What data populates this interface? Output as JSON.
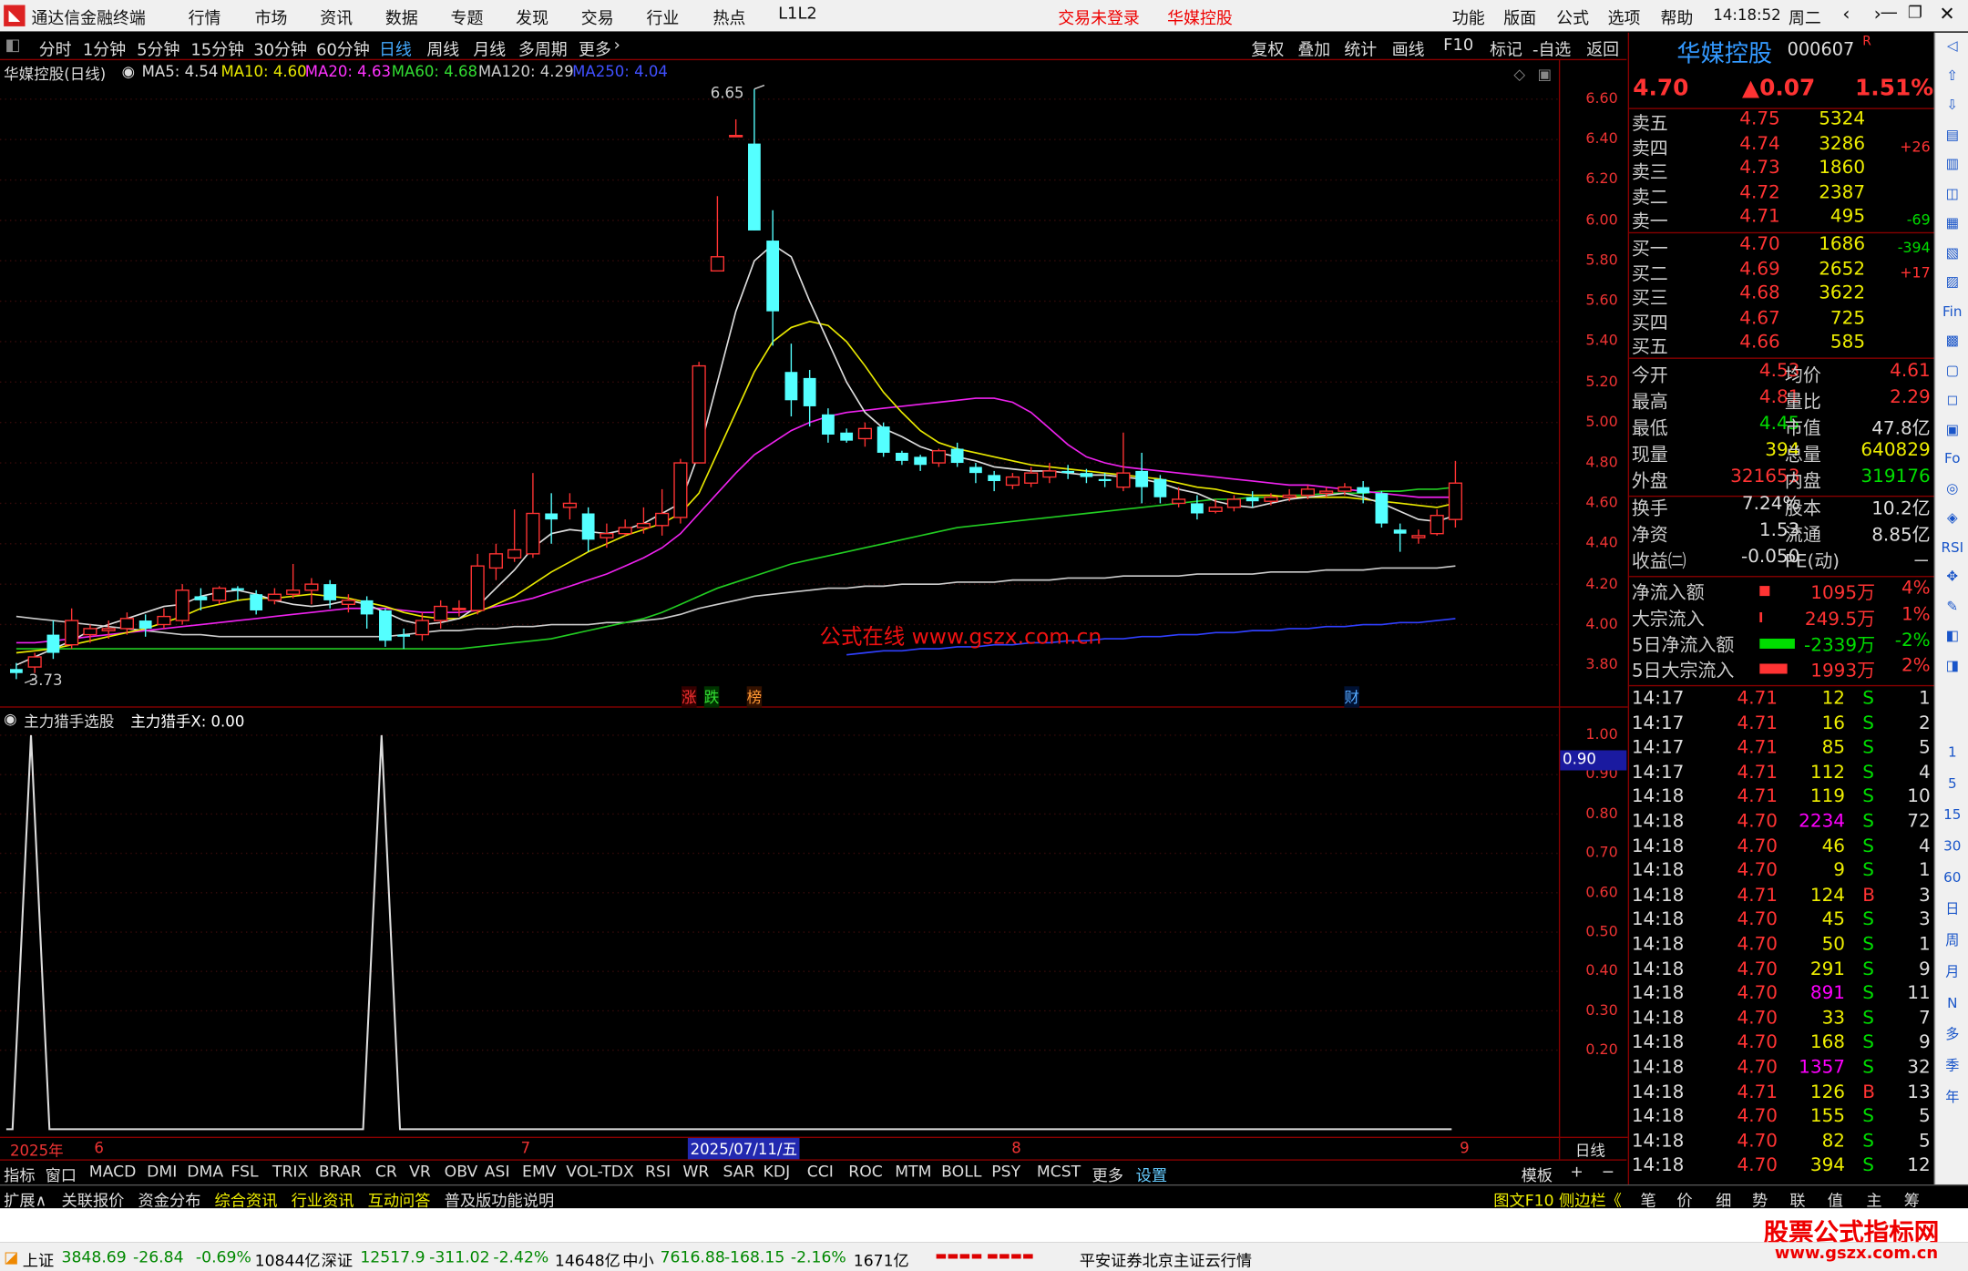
{
  "titlebar": {
    "app_name": "通达信金融终端",
    "menus": [
      "行情",
      "市场",
      "资讯",
      "数据",
      "专题",
      "发现",
      "交易",
      "行业",
      "热点",
      "L1L2"
    ],
    "trade_status": "交易未登录",
    "stock_name": "华媒控股",
    "right_menus": [
      "功能",
      "版面",
      "公式",
      "选项",
      "帮助"
    ],
    "time": "14:18:52",
    "weekday": "周二"
  },
  "periods": [
    "分时",
    "1分钟",
    "5分钟",
    "15分钟",
    "30分钟",
    "60分钟",
    "日线",
    "周线",
    "月线",
    "多周期",
    "更多"
  ],
  "active_period": "日线",
  "tools": [
    "复权",
    "叠加",
    "统计",
    "画线",
    "F10",
    "标记",
    "-自选",
    "返回"
  ],
  "main": {
    "title": "华媒控股(日线)",
    "ma": [
      {
        "label": "MA5: 4.54",
        "color": "#dddddd"
      },
      {
        "label": "MA10: 4.60",
        "color": "#e8e800"
      },
      {
        "label": "MA20: 4.63",
        "color": "#ff33ff"
      },
      {
        "label": "MA60: 4.68",
        "color": "#33dd33"
      },
      {
        "label": "MA120: 4.29",
        "color": "#cccccc"
      },
      {
        "label": "MA250: 4.04",
        "color": "#4050ff"
      }
    ],
    "high_label": "6.65",
    "low_label": "3.73",
    "watermark": "公式在线  www.gszx.com.cn",
    "markers": [
      "涨",
      "跌",
      "榜",
      "财"
    ]
  },
  "yaxis": [
    "6.60",
    "6.40",
    "6.20",
    "6.00",
    "5.80",
    "5.60",
    "5.40",
    "5.20",
    "5.00",
    "4.80",
    "4.60",
    "4.40",
    "4.20",
    "4.00",
    "3.80"
  ],
  "sub": {
    "title": "主力猎手选股",
    "value_label": "主力猎手X: 0.00",
    "yaxis": [
      "1.00",
      "0.90",
      "0.80",
      "0.70",
      "0.60",
      "0.50",
      "0.40",
      "0.30",
      "0.20"
    ],
    "marker": "0.90"
  },
  "xaxis": {
    "year": "2025年",
    "months": [
      "6",
      "7",
      "8",
      "9"
    ],
    "cursor_date": "2025/07/11/五",
    "period_label": "日线"
  },
  "chart_data": {
    "type": "candlestick",
    "ylim": [
      3.7,
      6.7
    ],
    "candles": [
      [
        3.78,
        3.76,
        3.81,
        3.73
      ],
      [
        3.79,
        3.84,
        3.86,
        3.76
      ],
      [
        3.95,
        3.86,
        4.02,
        3.83
      ],
      [
        3.9,
        4.02,
        4.08,
        3.88
      ],
      [
        3.95,
        3.98,
        4.0,
        3.91
      ],
      [
        3.97,
        3.98,
        4.02,
        3.93
      ],
      [
        3.98,
        4.03,
        4.06,
        3.95
      ],
      [
        4.02,
        3.98,
        4.05,
        3.94
      ],
      [
        4.0,
        4.04,
        4.08,
        3.98
      ],
      [
        4.02,
        4.17,
        4.2,
        4.0
      ],
      [
        4.14,
        4.12,
        4.18,
        4.07
      ],
      [
        4.12,
        4.18,
        4.19,
        4.1
      ],
      [
        4.18,
        4.17,
        4.19,
        4.12
      ],
      [
        4.15,
        4.07,
        4.17,
        4.05
      ],
      [
        4.12,
        4.15,
        4.18,
        4.1
      ],
      [
        4.15,
        4.17,
        4.3,
        4.13
      ],
      [
        4.17,
        4.2,
        4.23,
        4.1
      ],
      [
        4.2,
        4.12,
        4.22,
        4.08
      ],
      [
        4.1,
        4.12,
        4.15,
        4.06
      ],
      [
        4.12,
        4.05,
        4.14,
        3.98
      ],
      [
        4.07,
        3.92,
        4.08,
        3.89
      ],
      [
        3.95,
        3.94,
        3.98,
        3.88
      ],
      [
        3.95,
        4.02,
        4.06,
        3.92
      ],
      [
        4.02,
        4.09,
        4.12,
        3.98
      ],
      [
        4.08,
        4.08,
        4.12,
        4.04
      ],
      [
        4.07,
        4.29,
        4.35,
        4.05
      ],
      [
        4.28,
        4.35,
        4.4,
        4.22
      ],
      [
        4.33,
        4.37,
        4.57,
        4.31
      ],
      [
        4.35,
        4.55,
        4.75,
        4.33
      ],
      [
        4.55,
        4.52,
        4.65,
        4.4
      ],
      [
        4.58,
        4.6,
        4.65,
        4.52
      ],
      [
        4.55,
        4.42,
        4.58,
        4.36
      ],
      [
        4.43,
        4.45,
        4.5,
        4.38
      ],
      [
        4.45,
        4.48,
        4.52,
        4.44
      ],
      [
        4.48,
        4.5,
        4.58,
        4.45
      ],
      [
        4.49,
        4.55,
        4.67,
        4.44
      ],
      [
        4.53,
        4.8,
        4.82,
        4.5
      ],
      [
        4.8,
        5.28,
        5.3,
        5.0
      ],
      [
        5.75,
        5.82,
        6.12,
        5.75
      ],
      [
        6.42,
        6.42,
        6.5,
        6.42
      ],
      [
        6.38,
        5.95,
        6.65,
        5.95
      ],
      [
        5.9,
        5.55,
        6.05,
        5.38
      ],
      [
        5.25,
        5.11,
        5.39,
        5.03
      ],
      [
        5.22,
        5.08,
        5.26,
        4.98
      ],
      [
        5.04,
        4.94,
        5.07,
        4.9
      ],
      [
        4.95,
        4.91,
        4.97,
        4.9
      ],
      [
        4.92,
        4.97,
        5.0,
        4.88
      ],
      [
        4.98,
        4.85,
        5.0,
        4.83
      ],
      [
        4.85,
        4.81,
        4.86,
        4.79
      ],
      [
        4.83,
        4.79,
        4.84,
        4.76
      ],
      [
        4.8,
        4.86,
        4.87,
        4.78
      ],
      [
        4.87,
        4.8,
        4.9,
        4.78
      ],
      [
        4.78,
        4.75,
        4.8,
        4.7
      ],
      [
        4.74,
        4.71,
        4.76,
        4.66
      ],
      [
        4.69,
        4.73,
        4.75,
        4.67
      ],
      [
        4.7,
        4.75,
        4.78,
        4.68
      ],
      [
        4.73,
        4.76,
        4.8,
        4.7
      ],
      [
        4.76,
        4.75,
        4.79,
        4.72
      ],
      [
        4.75,
        4.73,
        4.77,
        4.7
      ],
      [
        4.72,
        4.71,
        4.75,
        4.68
      ],
      [
        4.68,
        4.75,
        4.95,
        4.66
      ],
      [
        4.76,
        4.68,
        4.85,
        4.6
      ],
      [
        4.72,
        4.63,
        4.74,
        4.6
      ],
      [
        4.6,
        4.62,
        4.68,
        4.58
      ],
      [
        4.6,
        4.55,
        4.64,
        4.52
      ],
      [
        4.56,
        4.58,
        4.62,
        4.55
      ],
      [
        4.58,
        4.62,
        4.64,
        4.56
      ],
      [
        4.63,
        4.61,
        4.66,
        4.58
      ],
      [
        4.61,
        4.63,
        4.65,
        4.59
      ],
      [
        4.63,
        4.64,
        4.67,
        4.61
      ],
      [
        4.64,
        4.67,
        4.69,
        4.62
      ],
      [
        4.65,
        4.66,
        4.68,
        4.63
      ],
      [
        4.66,
        4.68,
        4.7,
        4.64
      ],
      [
        4.68,
        4.65,
        4.71,
        4.6
      ],
      [
        4.65,
        4.5,
        4.66,
        4.48
      ],
      [
        4.47,
        4.45,
        4.5,
        4.36
      ],
      [
        4.43,
        4.44,
        4.47,
        4.4
      ],
      [
        4.45,
        4.54,
        4.57,
        4.44
      ],
      [
        4.52,
        4.7,
        4.81,
        4.48
      ]
    ]
  },
  "ma_lines": {
    "ma5": [
      3.8,
      3.84,
      3.88,
      3.92,
      3.97,
      4.0,
      4.03,
      4.06,
      4.09,
      4.1,
      4.14,
      4.16,
      4.17,
      4.15,
      4.12,
      4.1,
      4.09,
      4.1,
      4.12,
      4.1,
      4.06,
      4.02,
      4.0,
      4.01,
      4.03,
      4.09,
      4.18,
      4.27,
      4.38,
      4.45,
      4.47,
      4.46,
      4.45,
      4.47,
      4.5,
      4.55,
      4.6,
      4.85,
      5.2,
      5.55,
      5.8,
      5.88,
      5.82,
      5.6,
      5.4,
      5.2,
      5.05,
      4.97,
      4.93,
      4.88,
      4.85,
      4.83,
      4.81,
      4.78,
      4.77,
      4.76,
      4.76,
      4.75,
      4.74,
      4.74,
      4.73,
      4.72,
      4.7,
      4.67,
      4.65,
      4.61,
      4.59,
      4.58,
      4.6,
      4.62,
      4.63,
      4.64,
      4.65,
      4.63,
      4.6,
      4.56,
      4.52,
      4.51,
      4.54
    ],
    "ma10": [
      3.86,
      3.87,
      3.88,
      3.9,
      3.92,
      3.94,
      3.96,
      3.98,
      4.01,
      4.04,
      4.08,
      4.1,
      4.12,
      4.13,
      4.13,
      4.14,
      4.15,
      4.14,
      4.13,
      4.11,
      4.09,
      4.06,
      4.04,
      4.03,
      4.03,
      4.06,
      4.1,
      4.14,
      4.2,
      4.26,
      4.31,
      4.36,
      4.4,
      4.44,
      4.47,
      4.5,
      4.55,
      4.65,
      4.85,
      5.05,
      5.25,
      5.4,
      5.47,
      5.5,
      5.48,
      5.4,
      5.28,
      5.15,
      5.05,
      4.96,
      4.9,
      4.87,
      4.85,
      4.83,
      4.81,
      4.79,
      4.78,
      4.77,
      4.76,
      4.75,
      4.74,
      4.73,
      4.72,
      4.7,
      4.68,
      4.67,
      4.65,
      4.64,
      4.64,
      4.63,
      4.63,
      4.63,
      4.63,
      4.62,
      4.61,
      4.6,
      4.59,
      4.58,
      4.6
    ],
    "ma20": [
      3.91,
      3.91,
      3.92,
      3.93,
      3.94,
      3.95,
      3.96,
      3.97,
      3.98,
      3.99,
      4.0,
      4.01,
      4.02,
      4.03,
      4.04,
      4.05,
      4.06,
      4.07,
      4.08,
      4.08,
      4.08,
      4.07,
      4.06,
      4.06,
      4.06,
      4.07,
      4.09,
      4.11,
      4.13,
      4.16,
      4.19,
      4.22,
      4.25,
      4.29,
      4.33,
      4.38,
      4.45,
      4.55,
      4.65,
      4.75,
      4.84,
      4.9,
      4.96,
      5.0,
      5.03,
      5.05,
      5.06,
      5.07,
      5.08,
      5.09,
      5.1,
      5.11,
      5.12,
      5.12,
      5.1,
      5.05,
      4.97,
      4.89,
      4.83,
      4.8,
      4.78,
      4.77,
      4.76,
      4.75,
      4.74,
      4.73,
      4.72,
      4.71,
      4.7,
      4.69,
      4.69,
      4.68,
      4.67,
      4.66,
      4.65,
      4.64,
      4.63,
      4.63,
      4.63
    ],
    "ma60": [
      3.88,
      3.88,
      3.88,
      3.88,
      3.88,
      3.88,
      3.88,
      3.88,
      3.88,
      3.88,
      3.88,
      3.88,
      3.88,
      3.88,
      3.88,
      3.88,
      3.88,
      3.88,
      3.88,
      3.88,
      3.88,
      3.88,
      3.88,
      3.88,
      3.88,
      3.89,
      3.9,
      3.91,
      3.92,
      3.93,
      3.95,
      3.97,
      3.99,
      4.01,
      4.03,
      4.06,
      4.1,
      4.14,
      4.18,
      4.21,
      4.24,
      4.27,
      4.3,
      4.32,
      4.34,
      4.36,
      4.38,
      4.4,
      4.42,
      4.44,
      4.46,
      4.48,
      4.49,
      4.5,
      4.51,
      4.52,
      4.53,
      4.54,
      4.55,
      4.56,
      4.57,
      4.58,
      4.59,
      4.6,
      4.61,
      4.62,
      4.62,
      4.63,
      4.63,
      4.64,
      4.64,
      4.65,
      4.65,
      4.65,
      4.66,
      4.66,
      4.67,
      4.67,
      4.68
    ],
    "ma120": [
      4.04,
      4.03,
      4.02,
      4.01,
      4.0,
      3.99,
      3.98,
      3.97,
      3.96,
      3.95,
      3.95,
      3.94,
      3.94,
      3.94,
      3.94,
      3.94,
      3.94,
      3.94,
      3.94,
      3.94,
      3.94,
      3.95,
      3.96,
      3.97,
      3.97,
      3.98,
      3.98,
      3.99,
      3.99,
      4.0,
      4.0,
      4.0,
      4.01,
      4.01,
      4.02,
      4.03,
      4.05,
      4.08,
      4.1,
      4.12,
      4.14,
      4.15,
      4.16,
      4.17,
      4.18,
      4.18,
      4.19,
      4.19,
      4.2,
      4.2,
      4.2,
      4.21,
      4.21,
      4.21,
      4.22,
      4.22,
      4.22,
      4.23,
      4.23,
      4.23,
      4.24,
      4.24,
      4.24,
      4.24,
      4.25,
      4.25,
      4.25,
      4.25,
      4.26,
      4.26,
      4.26,
      4.27,
      4.27,
      4.27,
      4.28,
      4.28,
      4.28,
      4.28,
      4.29
    ],
    "ma250_start_index": 45,
    "ma250": [
      3.85,
      3.86,
      3.87,
      3.87,
      3.88,
      3.88,
      3.89,
      3.89,
      3.9,
      3.9,
      3.91,
      3.91,
      3.92,
      3.92,
      3.93,
      3.93,
      3.94,
      3.94,
      3.95,
      3.95,
      3.96,
      3.96,
      3.97,
      3.97,
      3.98,
      3.98,
      3.99,
      3.99,
      4.0,
      4.0,
      4.01,
      4.01,
      4.02,
      4.03
    ]
  },
  "sub_series": [
    0.0,
    1.0,
    0.0,
    0.0,
    0.0,
    0.0,
    0.0,
    0.0,
    0.0,
    0.0,
    0.0,
    0.0,
    0.0,
    0.0,
    0.0,
    0.0,
    0.0,
    0.0,
    0.0,
    0.0,
    1.0,
    0.0,
    0.0,
    0.0,
    0.0,
    0.0,
    0.0,
    0.0,
    0.0,
    0.0,
    0.0,
    0.0,
    0.0,
    0.0,
    0.0,
    0.0,
    0.0,
    0.0,
    0.0,
    0.0,
    0.0,
    0.0,
    0.0,
    0.0,
    0.0,
    0.0,
    0.0,
    0.0,
    0.0,
    0.0,
    0.0,
    0.0,
    0.0,
    0.0,
    0.0,
    0.0,
    0.0,
    0.0,
    0.0,
    0.0,
    0.0,
    0.0,
    0.0,
    0.0,
    0.0,
    0.0,
    0.0,
    0.0,
    0.0,
    0.0,
    0.0,
    0.0,
    0.0,
    0.0,
    0.0,
    0.0,
    0.0,
    0.0,
    0.0
  ],
  "quote": {
    "name": "华媒控股",
    "code": "000607",
    "r": "R",
    "price": "4.70",
    "change": "▲0.07",
    "pct": "1.51%",
    "asks": [
      {
        "label": "卖五",
        "price": "4.75",
        "vol": "5324",
        "chg": ""
      },
      {
        "label": "卖四",
        "price": "4.74",
        "vol": "3286",
        "chg": "+26"
      },
      {
        "label": "卖三",
        "price": "4.73",
        "vol": "1860",
        "chg": ""
      },
      {
        "label": "卖二",
        "price": "4.72",
        "vol": "2387",
        "chg": ""
      },
      {
        "label": "卖一",
        "price": "4.71",
        "vol": "495",
        "chg": "-69"
      }
    ],
    "bids": [
      {
        "label": "买一",
        "price": "4.70",
        "vol": "1686",
        "chg": "-394"
      },
      {
        "label": "买二",
        "price": "4.69",
        "vol": "2652",
        "chg": "+17"
      },
      {
        "label": "买三",
        "price": "4.68",
        "vol": "3622",
        "chg": ""
      },
      {
        "label": "买四",
        "price": "4.67",
        "vol": "725",
        "chg": ""
      },
      {
        "label": "买五",
        "price": "4.66",
        "vol": "585",
        "chg": ""
      }
    ],
    "stats": [
      {
        "l1": "今开",
        "v1": "4.53",
        "l2": "均价",
        "v2": "4.61"
      },
      {
        "l1": "最高",
        "v1": "4.81",
        "l2": "量比",
        "v2": "2.29"
      },
      {
        "l1": "最低",
        "v1": "4.45",
        "l2": "市值",
        "v2": "47.8亿"
      },
      {
        "l1": "现量",
        "v1": "394",
        "l2": "总量",
        "v2": "640829"
      },
      {
        "l1": "外盘",
        "v1": "321653",
        "l2": "内盘",
        "v2": "319176"
      }
    ],
    "stats2": [
      {
        "l1": "换手",
        "v1": "7.24%",
        "l2": "股本",
        "v2": "10.2亿"
      },
      {
        "l1": "净资",
        "v1": "1.53",
        "l2": "流通",
        "v2": "8.85亿"
      },
      {
        "l1": "收益㈡",
        "v1": "-0.050",
        "l2": "PE(动)",
        "v2": "－"
      }
    ],
    "flows": [
      {
        "label": "净流入额",
        "value": "1095万",
        "pct": "4%",
        "bar": 0.28,
        "color": "#ff3333"
      },
      {
        "label": "大宗流入",
        "value": "249.5万",
        "pct": "1%",
        "bar": 0.05,
        "color": "#ff3333"
      },
      {
        "label": "5日净流入额",
        "value": "-2339万",
        "pct": "-2%",
        "bar": 1.0,
        "color": "#00dd00"
      },
      {
        "label": "5日大宗流入",
        "value": "1993万",
        "pct": "2%",
        "bar": 0.8,
        "color": "#ff3333"
      }
    ],
    "ticks": [
      [
        "14:17",
        "4.71",
        "12",
        "S",
        "1"
      ],
      [
        "14:17",
        "4.71",
        "16",
        "S",
        "2"
      ],
      [
        "14:17",
        "4.71",
        "85",
        "S",
        "5"
      ],
      [
        "14:17",
        "4.71",
        "112",
        "S",
        "4"
      ],
      [
        "14:18",
        "4.71",
        "119",
        "S",
        "10"
      ],
      [
        "14:18",
        "4.70",
        "2234",
        "S",
        "72"
      ],
      [
        "14:18",
        "4.70",
        "46",
        "S",
        "4"
      ],
      [
        "14:18",
        "4.70",
        "9",
        "S",
        "1"
      ],
      [
        "14:18",
        "4.71",
        "124",
        "B",
        "3"
      ],
      [
        "14:18",
        "4.70",
        "45",
        "S",
        "3"
      ],
      [
        "14:18",
        "4.70",
        "50",
        "S",
        "1"
      ],
      [
        "14:18",
        "4.70",
        "291",
        "S",
        "9"
      ],
      [
        "14:18",
        "4.70",
        "891",
        "S",
        "11"
      ],
      [
        "14:18",
        "4.70",
        "33",
        "S",
        "7"
      ],
      [
        "14:18",
        "4.70",
        "168",
        "S",
        "9"
      ],
      [
        "14:18",
        "4.70",
        "1357",
        "S",
        "32"
      ],
      [
        "14:18",
        "4.71",
        "126",
        "B",
        "13"
      ],
      [
        "14:18",
        "4.70",
        "155",
        "S",
        "5"
      ],
      [
        "14:18",
        "4.70",
        "82",
        "S",
        "5"
      ],
      [
        "14:18",
        "4.70",
        "394",
        "S",
        "12"
      ]
    ],
    "tabs": [
      "笔",
      "价",
      "细",
      "势",
      "联",
      "值",
      "主",
      "筹"
    ]
  },
  "indicators": [
    "指标",
    "窗口",
    "MACD",
    "DMI",
    "DMA",
    "FSL",
    "TRIX",
    "BRAR",
    "CR",
    "VR",
    "OBV",
    "ASI",
    "EMV",
    "VOL-TDX",
    "RSI",
    "WR",
    "SAR",
    "KDJ",
    "CCI",
    "ROC",
    "MTM",
    "BOLL",
    "PSY",
    "MCST",
    "更多",
    "设置"
  ],
  "ind_right": [
    "模板",
    "+",
    "−"
  ],
  "extbar": [
    "扩展∧",
    "关联报价",
    "资金分布",
    "综合资讯",
    "行业资讯",
    "互动问答",
    "普及版功能说明"
  ],
  "extbar_right": "图文F10 侧边栏《",
  "status": {
    "sh_label": "上证",
    "sh_val": "3848.69",
    "sh_chg": "-26.84",
    "sh_pct": "-0.69%",
    "sh_amt": "10844亿",
    "sz_label": "深证",
    "sz_val": "12517.9",
    "sz_chg": "-311.02",
    "sz_pct": "-2.42%",
    "sz_amt": "14648亿",
    "zx_label": "中小",
    "zx_val": "7616.88",
    "zx_chg": "-168.15",
    "zx_pct": "-2.16%",
    "zx_amt": "1671亿",
    "broker": "平安证券北京主证云行情"
  },
  "brand": {
    "line1": "股票公式指标网",
    "line2": "www.gszx.com.cn"
  },
  "sidebar_items": [
    "1",
    "5",
    "15",
    "30",
    "60",
    "日",
    "周",
    "月",
    "N",
    "多",
    "季",
    "年"
  ]
}
